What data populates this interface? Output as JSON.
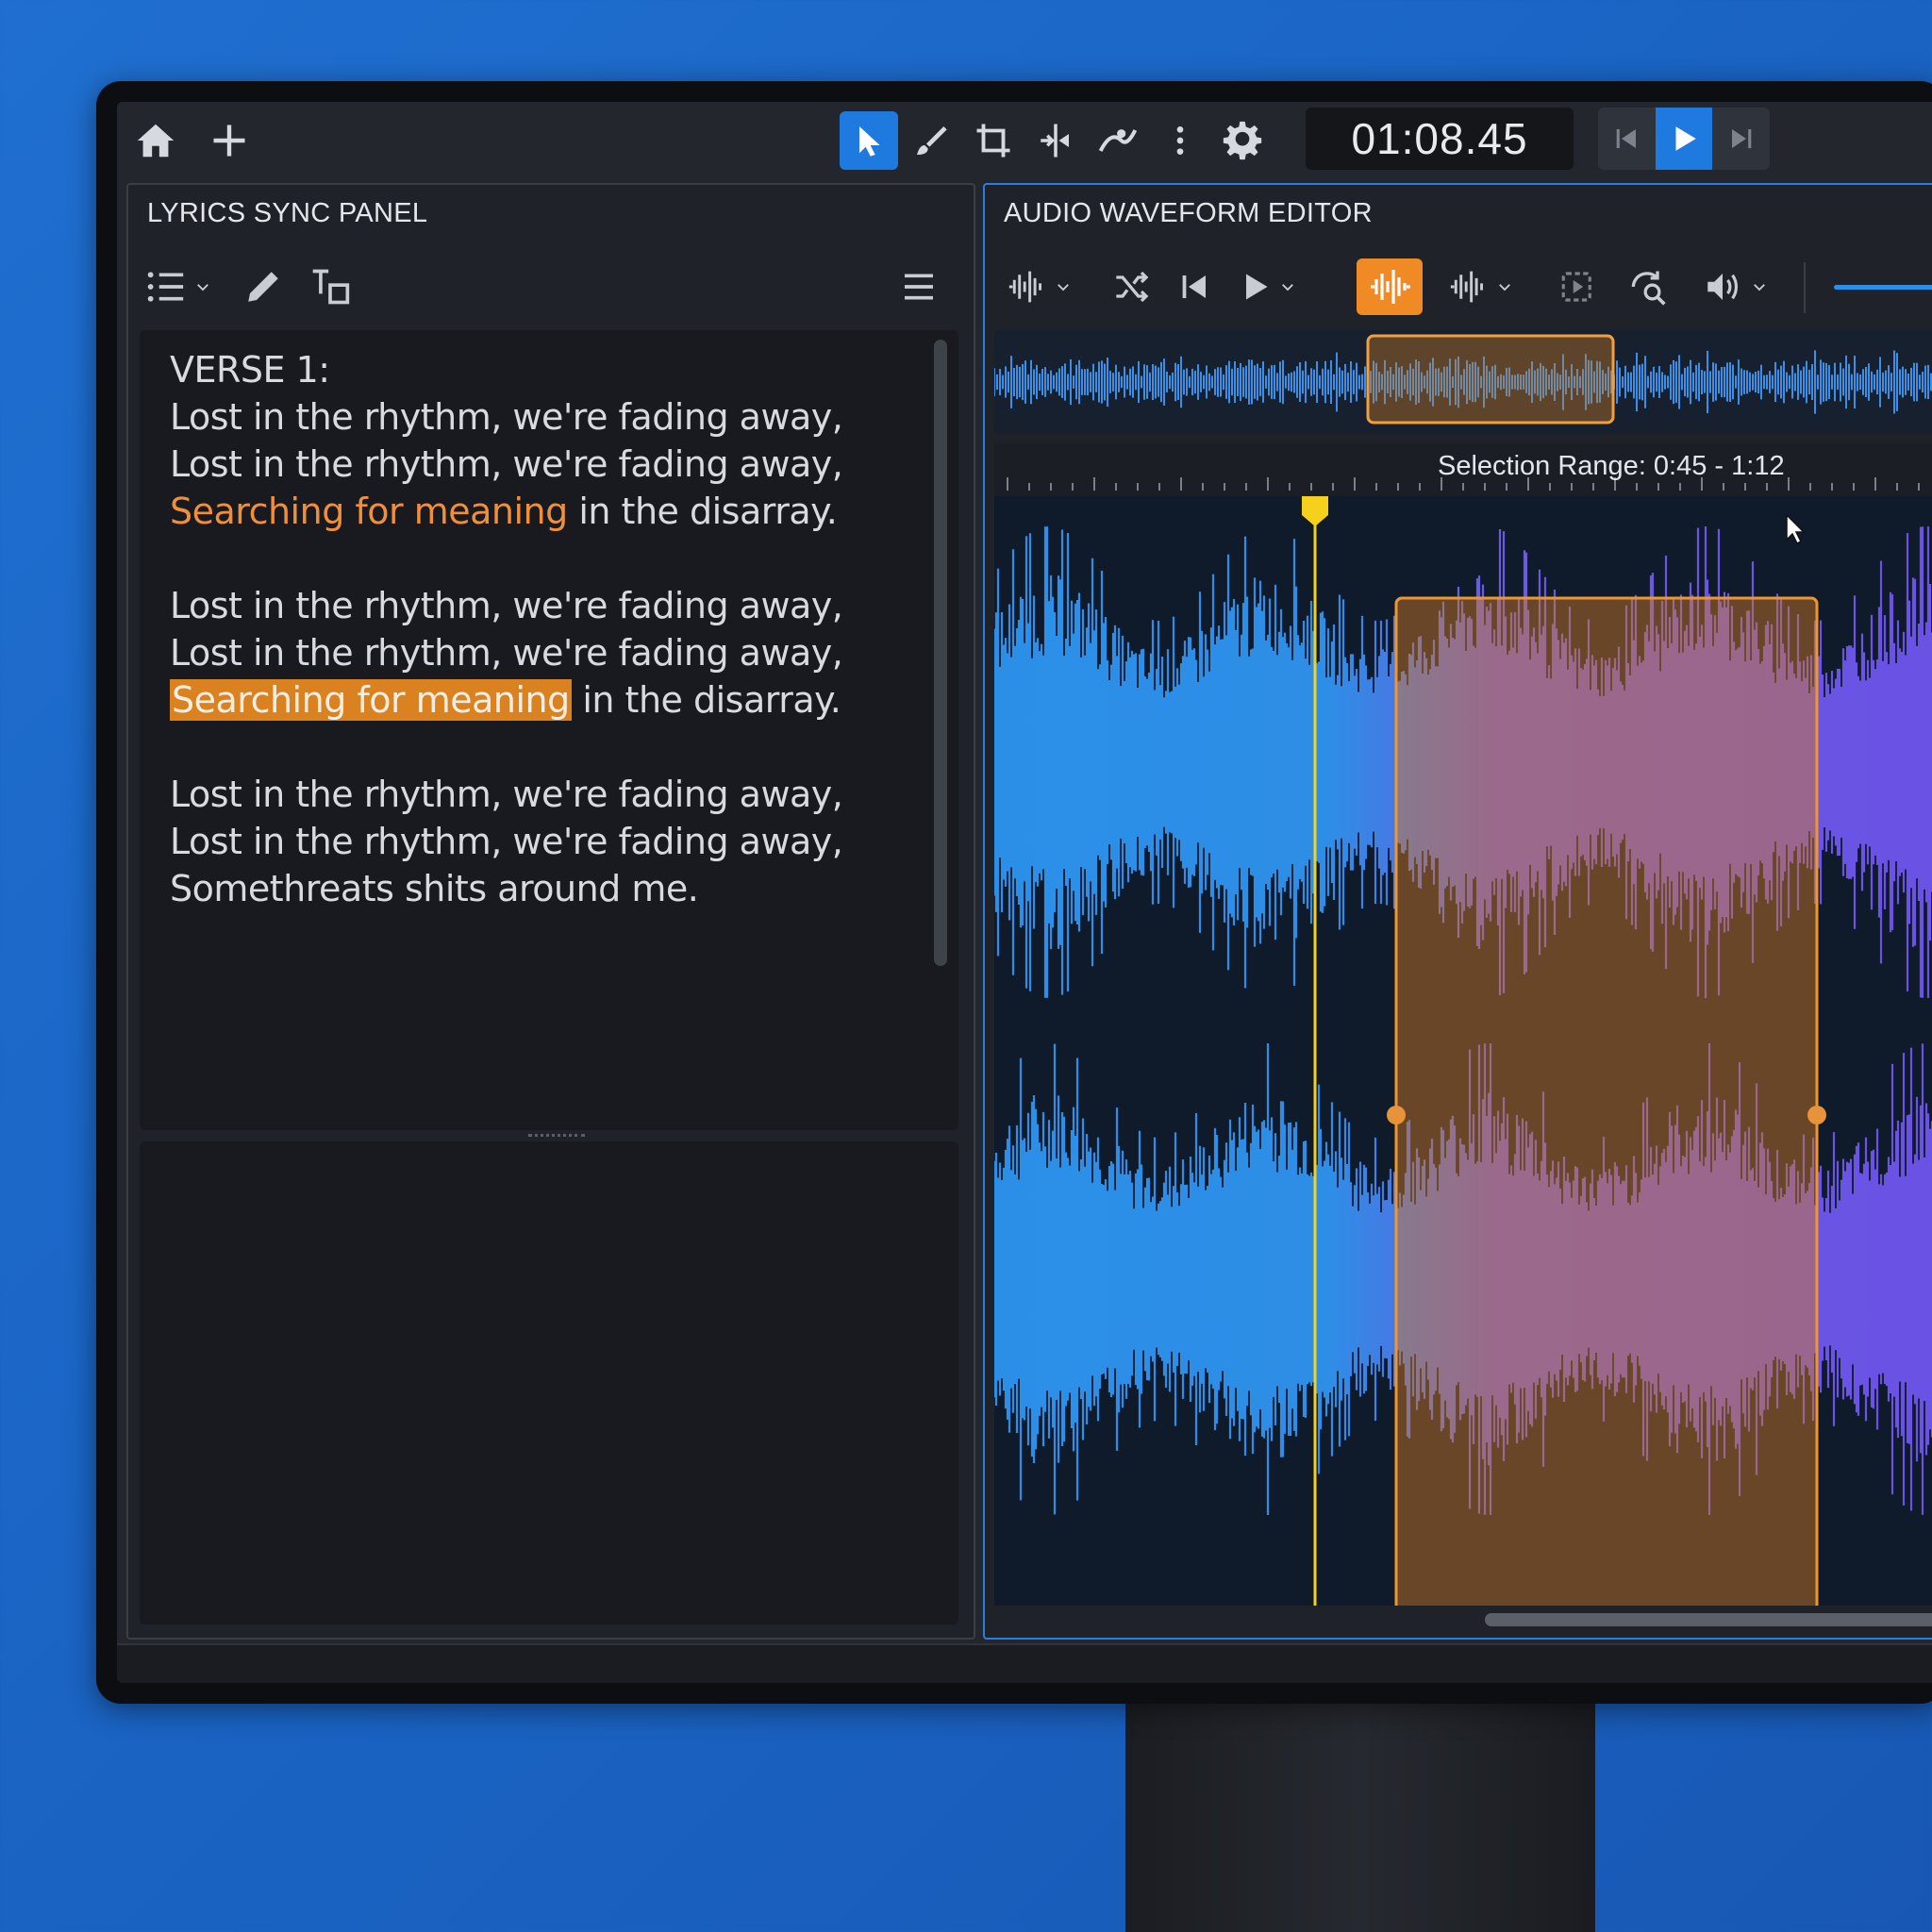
{
  "toolbar": {
    "timecode": "01:08.45",
    "icons": [
      "home-icon",
      "plus-icon",
      "pointer-icon",
      "brush-icon",
      "crop-icon",
      "split-icon",
      "fade-icon",
      "more-vertical-icon",
      "gear-icon"
    ],
    "active_tool": "pointer-icon"
  },
  "lyrics_panel": {
    "title": "LYRICS SYNC PANEL",
    "lines": [
      "VERSE 1:",
      "Lost in the rhythm, we're fading away,",
      "Lost in the rhythm, we're fading away,",
      "Searching for meaning",
      " in the disarray.",
      "Lost in the rhythm, we're fading away,",
      "Lost in the rhythm, we're fading away,",
      "Searching for meaning",
      " in the disarray.",
      "Lost in the rhythm, we're fading away,",
      "Lost in the rhythm, we're fading away,",
      "Somethreats shits around me."
    ]
  },
  "wave_panel": {
    "title": "AUDIO WAVEFORM EDITOR",
    "selection_label": "Selection Range: 0:45 - 1:12",
    "selection_start": 0.45,
    "selection_end": 1.12
  },
  "colors": {
    "accent_blue": "#1f7ae0",
    "accent_orange": "#f08a24",
    "wave_blue": "#2b8fe8",
    "wave_purple": "#6a5ae0",
    "playhead": "#f5d11c"
  }
}
